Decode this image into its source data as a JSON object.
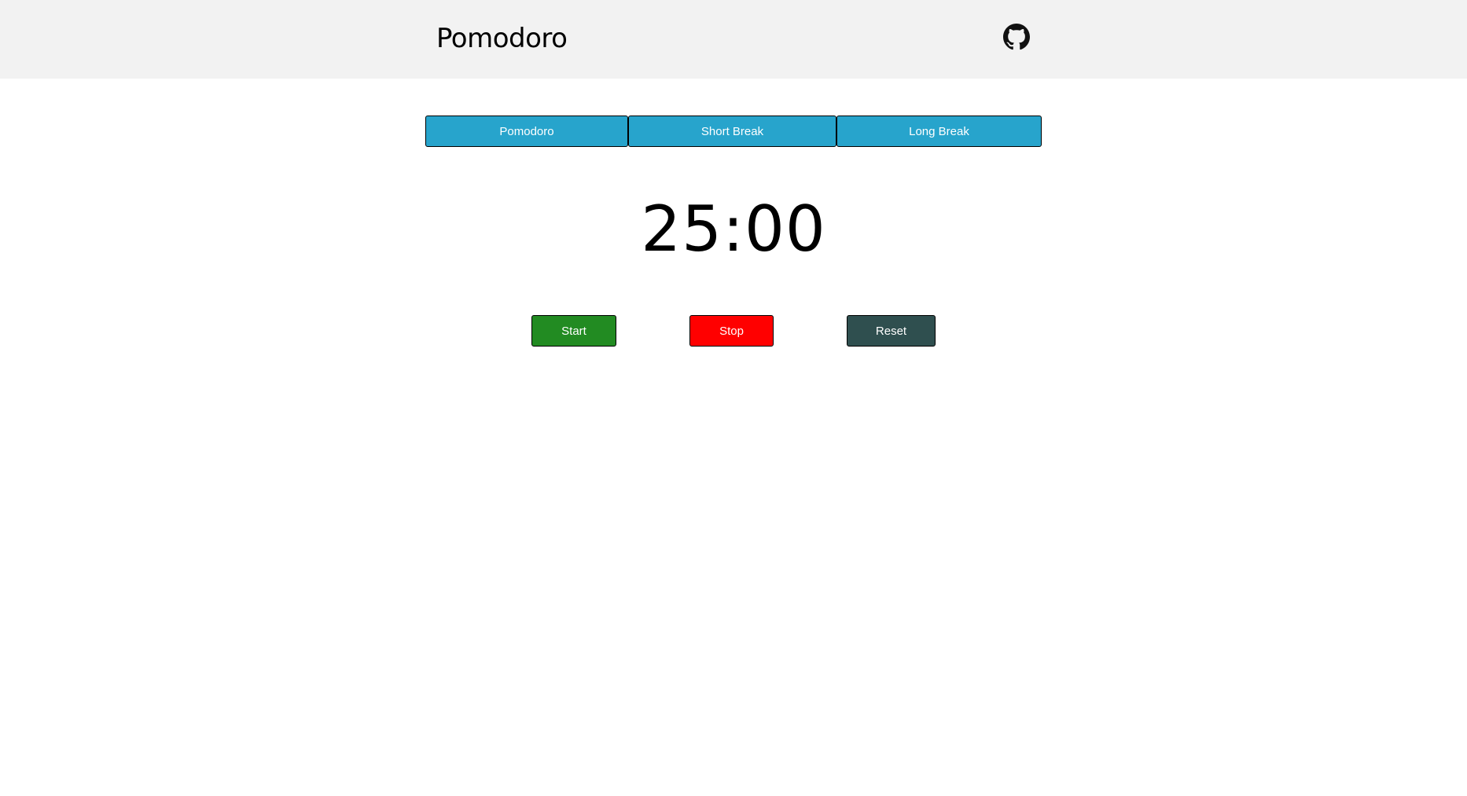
{
  "header": {
    "title": "Pomodoro",
    "github_icon": "github-icon"
  },
  "tabs": [
    {
      "label": "Pomodoro"
    },
    {
      "label": "Short Break"
    },
    {
      "label": "Long Break"
    }
  ],
  "timer": {
    "display": "25:00"
  },
  "controls": {
    "start_label": "Start",
    "stop_label": "Stop",
    "reset_label": "Reset"
  },
  "colors": {
    "header_bg": "#f2f2f2",
    "tab_bg": "#27a4cc",
    "start_bg": "#228b22",
    "stop_bg": "#ff0000",
    "reset_bg": "#2f4f4f"
  }
}
